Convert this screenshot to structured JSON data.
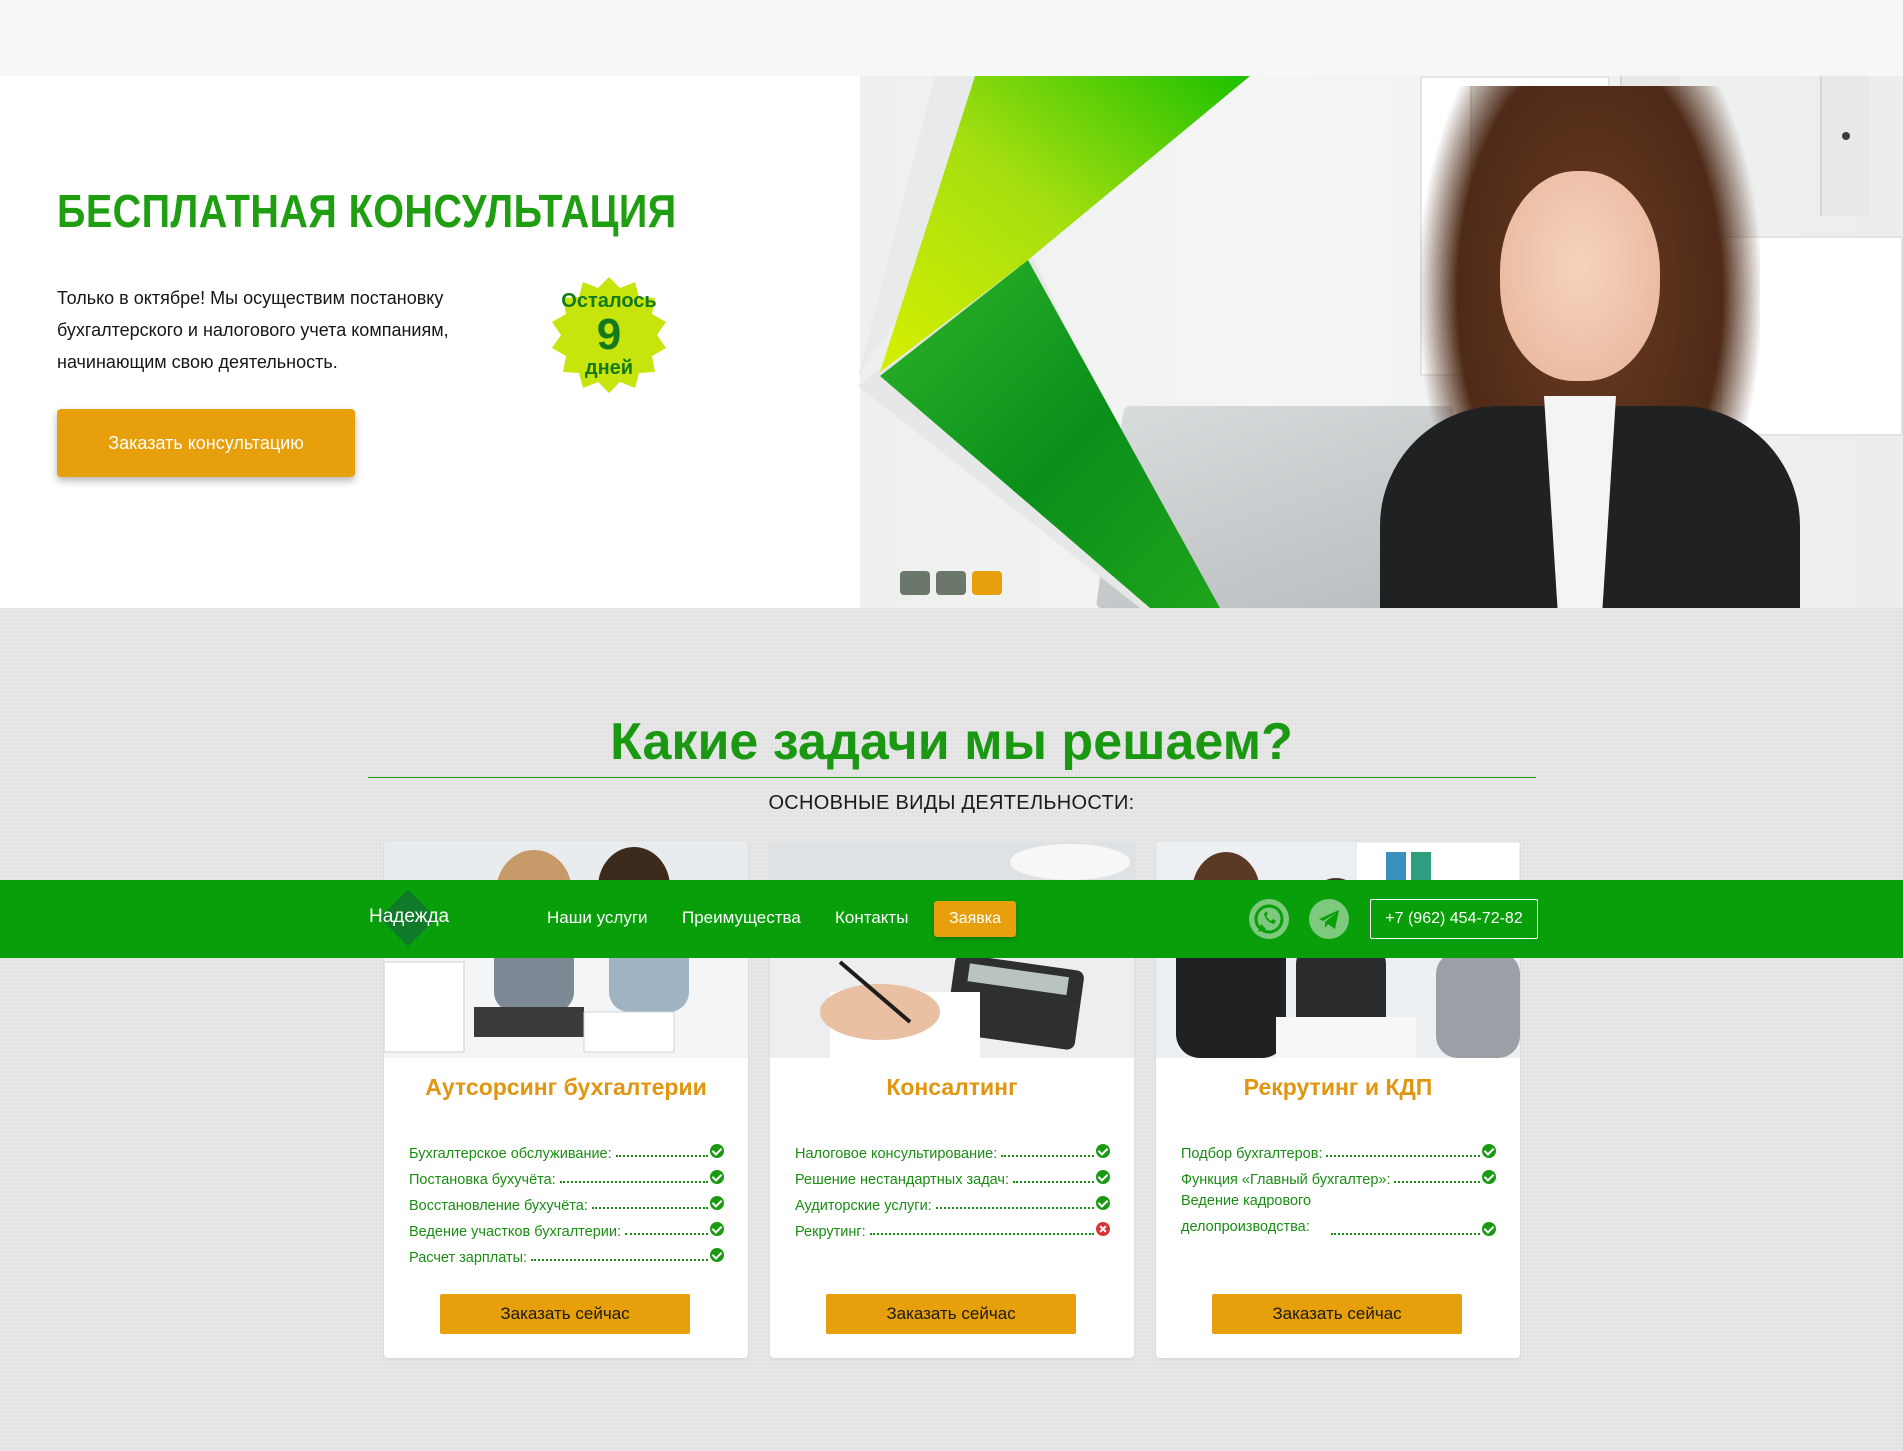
{
  "hero": {
    "title": "БЕСПЛАТНАЯ КОНСУЛЬТАЦИЯ",
    "text": "Только в октябре! Мы осуществим постановку бухгалтерского и налогового учета компаниям, начинающим свою деятельность.",
    "button_label": "Заказать консультацию",
    "badge": {
      "top": "Осталось",
      "number": "9",
      "bottom": "дней"
    },
    "slides": {
      "count": 3,
      "active": 3
    }
  },
  "colors": {
    "green": "#1a9812",
    "accent": "#e7a00b",
    "navbar": "#089f0a"
  },
  "services": {
    "title": "Какие задачи мы решаем?",
    "subtitle": "ОСНОВНЫЕ ВИДЫ ДЕЯТЕЛЬНОСТИ:",
    "cards": [
      {
        "title": "Аутсорсинг бухгалтерии",
        "features": [
          {
            "label": "Бухгалтерское обслуживание:",
            "ok": true
          },
          {
            "label": "Постановка бухучёта:",
            "ok": true
          },
          {
            "label": "Восстановление бухучёта:",
            "ok": true
          },
          {
            "label": "Ведение участков бухгалтерии:",
            "ok": true
          },
          {
            "label": "Расчет зарплаты:",
            "ok": true
          }
        ],
        "button_label": "Заказать сейчас"
      },
      {
        "title": "Консалтинг",
        "features": [
          {
            "label": "Налоговое консультирование:",
            "ok": true
          },
          {
            "label": "Решение нестандартных задач:",
            "ok": true
          },
          {
            "label": "Аудиторские услуги:",
            "ok": true
          },
          {
            "label": "Рекрутинг:",
            "ok": false
          }
        ],
        "button_label": "Заказать сейчас"
      },
      {
        "title": "Рекрутинг и КДП",
        "features": [
          {
            "label": "Подбор бухгалтеров:",
            "ok": true
          },
          {
            "label": "Функция «Главный бухгалтер»:",
            "ok": true
          },
          {
            "label": "Ведение кадрового делопроизводства:",
            "ok": true
          }
        ],
        "button_label": "Заказать сейчас"
      }
    ]
  },
  "nav": {
    "logo": "Надежда",
    "links": [
      "Наши услуги",
      "Преимущества",
      "Контакты"
    ],
    "cta": "Заявка",
    "phone": "+7 (962) 454-72-82",
    "icons": [
      "whatsapp-icon",
      "telegram-icon"
    ]
  }
}
